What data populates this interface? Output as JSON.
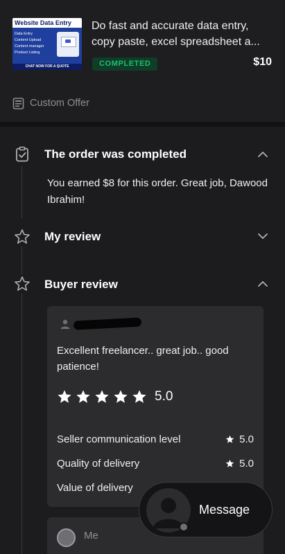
{
  "gig": {
    "thumbnail": {
      "heading": "Website Data Entry",
      "items": [
        "Data Entry",
        "Content Upload",
        "Content manager",
        "Product Listing"
      ],
      "cta": "CHAT NOW FOR A QUOTE"
    },
    "title": "Do fast and accurate data entry, copy paste, excel spreadsheet a...",
    "status": "COMPLETED",
    "price": "$10",
    "custom_offer_label": "Custom Offer"
  },
  "timeline": {
    "completed": {
      "title": "The order was completed",
      "message": "You earned $8 for this order. Great job, Dawood Ibrahim!"
    },
    "my_review": {
      "title": "My review"
    },
    "buyer_review": {
      "title": "Buyer review",
      "text": "Excellent freelancer.. great job.. good patience!",
      "rating": 5,
      "overall": "5.0",
      "breakdown": [
        {
          "label": "Seller communication level",
          "value": "5.0"
        },
        {
          "label": "Quality of delivery",
          "value": "5.0"
        },
        {
          "label": "Value of delivery",
          "value": ""
        }
      ],
      "me_label": "Me"
    }
  },
  "message_button": {
    "label": "Message"
  },
  "colors": {
    "background": "#1c1c1e",
    "card": "#2c2c2e",
    "status_green": "#1dbf73",
    "text_muted": "#8e8e93"
  },
  "icons": [
    "receipt-icon",
    "clipboard-check-icon",
    "star-outline-icon",
    "chevron-up-icon",
    "chevron-down-icon",
    "star-icon",
    "person-icon"
  ]
}
